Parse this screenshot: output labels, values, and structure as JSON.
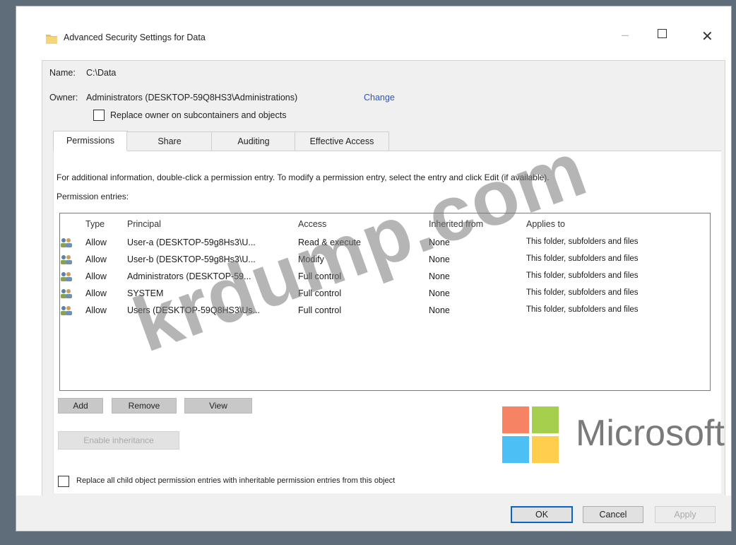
{
  "window": {
    "title": "Advanced Security Settings for Data"
  },
  "name_label": "Name:",
  "name_value": "C:\\Data",
  "owner_label": "Owner:",
  "owner_value": "Administrators (DESKTOP-59Q8HS3\\Administrations)",
  "owner_change": "Change",
  "replace_owner_label": "Replace owner on subcontainers and objects",
  "tabs": [
    {
      "label": "Permissions",
      "active": true
    },
    {
      "label": "Share",
      "active": false
    },
    {
      "label": "Auditing",
      "active": false
    },
    {
      "label": "Effective Access",
      "active": false
    }
  ],
  "info_text": "For additional information, double-click a permission entry. To modify a permission entry, select the entry and click Edit (if available).",
  "entries_label": "Permission entries:",
  "columns": {
    "type": "Type",
    "principal": "Principal",
    "access": "Access",
    "inherited": "Inherited from",
    "applies": "Applies to"
  },
  "rows": [
    {
      "type": "Allow",
      "principal": "User-a (DESKTOP-59g8Hs3\\U...",
      "access": "Read & execute",
      "inherited": "None",
      "applies": "This folder, subfolders and files"
    },
    {
      "type": "Allow",
      "principal": "User-b (DESKTOP-59g8Hs3\\U...",
      "access": "Modify",
      "inherited": "None",
      "applies": "This folder, subfolders and files"
    },
    {
      "type": "Allow",
      "principal": "Administrators (DESKTOP-59...",
      "access": "Full control",
      "inherited": "None",
      "applies": "This folder, subfolders and files"
    },
    {
      "type": "Allow",
      "principal": "SYSTEM",
      "access": "Full control",
      "inherited": "None",
      "applies": "This folder, subfolders and files"
    },
    {
      "type": "Allow",
      "principal": "Users (DESKTOP-59Q8HS3\\Us...",
      "access": "Full control",
      "inherited": "None",
      "applies": "This folder, subfolders and files"
    }
  ],
  "buttons": {
    "add": "Add",
    "remove": "Remove",
    "view": "View",
    "enable_inheritance": "Enable inheritance"
  },
  "replace_child_label": "Replace all child object permission entries with inheritable permission entries from this object",
  "footer": {
    "ok": "OK",
    "cancel": "Cancel",
    "apply": "Apply"
  },
  "watermark": "krdump.com",
  "brand": {
    "text": "Microsoft",
    "colors": [
      "#f25022",
      "#7fba00",
      "#00a4ef",
      "#ffb900"
    ]
  }
}
